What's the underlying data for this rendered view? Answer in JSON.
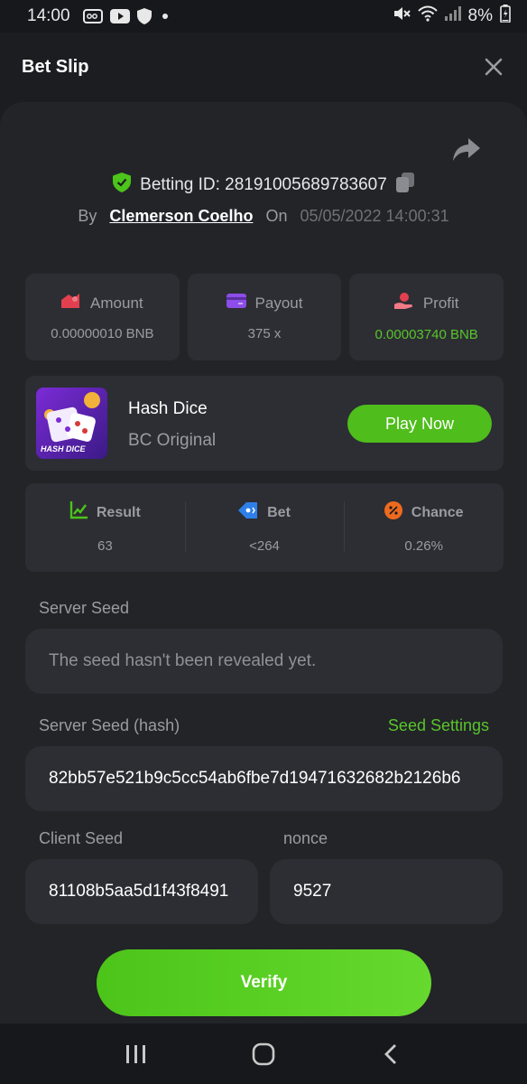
{
  "status_bar": {
    "time": "14:00",
    "battery": "8%"
  },
  "header": {
    "title": "Bet Slip"
  },
  "bet": {
    "betting_id_label": "Betting ID: 28191005689783607",
    "by_label": "By",
    "user": "Clemerson Coelho",
    "on_label": "On",
    "date": "05/05/2022 14:00:31"
  },
  "stats": [
    {
      "label": "Amount",
      "value": "0.00000010 BNB",
      "icon": "amount-icon"
    },
    {
      "label": "Payout",
      "value": "375 x",
      "icon": "payout-icon"
    },
    {
      "label": "Profit",
      "value": "0.00003740 BNB",
      "icon": "profit-icon"
    }
  ],
  "game": {
    "name": "Hash Dice",
    "subtitle": "BC Original",
    "thumb_text": "HASH DICE",
    "play_label": "Play Now"
  },
  "result": [
    {
      "label": "Result",
      "value": "63"
    },
    {
      "label": "Bet",
      "value": "<264"
    },
    {
      "label": "Chance",
      "value": "0.26%"
    }
  ],
  "server_seed": {
    "label": "Server Seed",
    "value": "The seed hasn't been revealed yet."
  },
  "server_seed_hash": {
    "label": "Server Seed (hash)",
    "link": "Seed Settings",
    "value": "82bb57e521b9c5cc54ab6fbe7d19471632682b2126b6"
  },
  "client_seed": {
    "label": "Client Seed",
    "value": "81108b5aa5d1f43f8491"
  },
  "nonce": {
    "label": "nonce",
    "value": "9527"
  },
  "verify_label": "Verify",
  "colors": {
    "background": "#1c1d20",
    "card": "#222428",
    "box": "#2c2e33",
    "accent_green": "#59c42b",
    "muted": "#9a9ca1"
  }
}
